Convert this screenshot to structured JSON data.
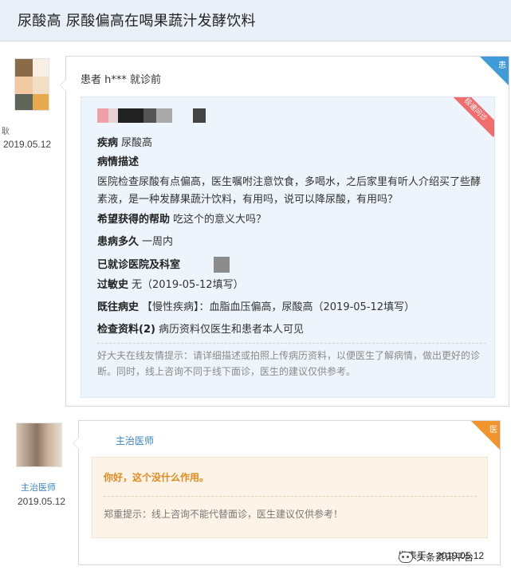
{
  "page": {
    "title": "尿酸高 尿酸偏高在喝果蔬汁发酵饮料"
  },
  "patient": {
    "name_fragment": "耿",
    "date": "2019.05.12",
    "card_corner": "患",
    "header": "患者 h*** 就诊前",
    "ribbon": "极速问诊",
    "disease": {
      "label": "疾病",
      "value": "尿酸高"
    },
    "condition_label": "病情描述",
    "condition_text": "医院检查尿酸有点偏高，医生嘱咐注意饮食，多喝水，之后家里有听人介绍买了些酵素液，是一种发酵果蔬汁饮料，有用吗，说可以降尿酸，有用吗？",
    "help": {
      "label": "希望获得的帮助",
      "value": "吃这个的意义大吗？"
    },
    "duration": {
      "label": "患病多久",
      "value": "一周内"
    },
    "hospital": {
      "label": "已就诊医院及科室",
      "value": ""
    },
    "allergy": {
      "label": "过敏史",
      "value": "无（2019-05-12填写）"
    },
    "history": {
      "label": "既往病史",
      "value": "【慢性疾病】：血脂血压偏高，尿酸高（2019-05-12填写）"
    },
    "exam": {
      "label": "检查资料(2)",
      "value": "病历资料仅医生和患者本人可见"
    },
    "tip": "好大夫在线友情提示：请详细描述或拍照上传病历资料，以便医生了解病情，做出更好的诊断。同时，线上咨询不同于线下面诊，医生的建议仅供参考。"
  },
  "doctor": {
    "role": "主治医师",
    "date": "2019.05.12",
    "card_corner": "医",
    "name": "主治医师",
    "reply": "你好，这个没什么作用。",
    "tip": "郑重提示：线上咨询不能代替面诊，医生建议仅供参考！",
    "sent": "发表于：2019.05.12"
  },
  "watermark": "头条资讯平台",
  "colors": {
    "accent_blue": "#3f9ad8",
    "accent_orange": "#f0952c",
    "ribbon_red": "#ef6d6d",
    "info_bg": "#eef4fb",
    "reply_bg": "#fdf3e6"
  }
}
